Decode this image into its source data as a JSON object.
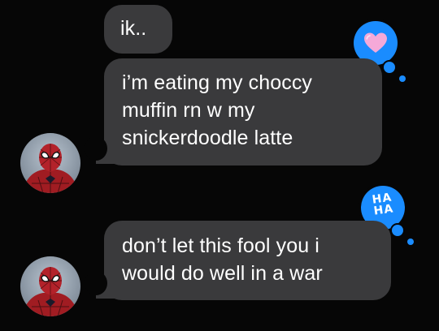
{
  "messages": [
    {
      "text": "ik..",
      "tapback": null,
      "avatar": false
    },
    {
      "text": "i’m eating my choccy\nmuffin rn w my\nsnickerdoodle latte",
      "tapback": "heart",
      "avatar": true
    },
    {
      "text": "don’t let this fool you i\nwould do well in a war",
      "tapback": "haha",
      "avatar": true
    }
  ],
  "tapbacks": {
    "heart": {
      "icon": "heart-icon",
      "color": "#f5a9d8"
    },
    "haha": {
      "icon": "haha-icon",
      "line1": "HA",
      "line2": "HA"
    }
  },
  "colors": {
    "background": "#060606",
    "bubble": "#3a3a3c",
    "tapback": "#1a8cff",
    "text": "#ffffff"
  }
}
